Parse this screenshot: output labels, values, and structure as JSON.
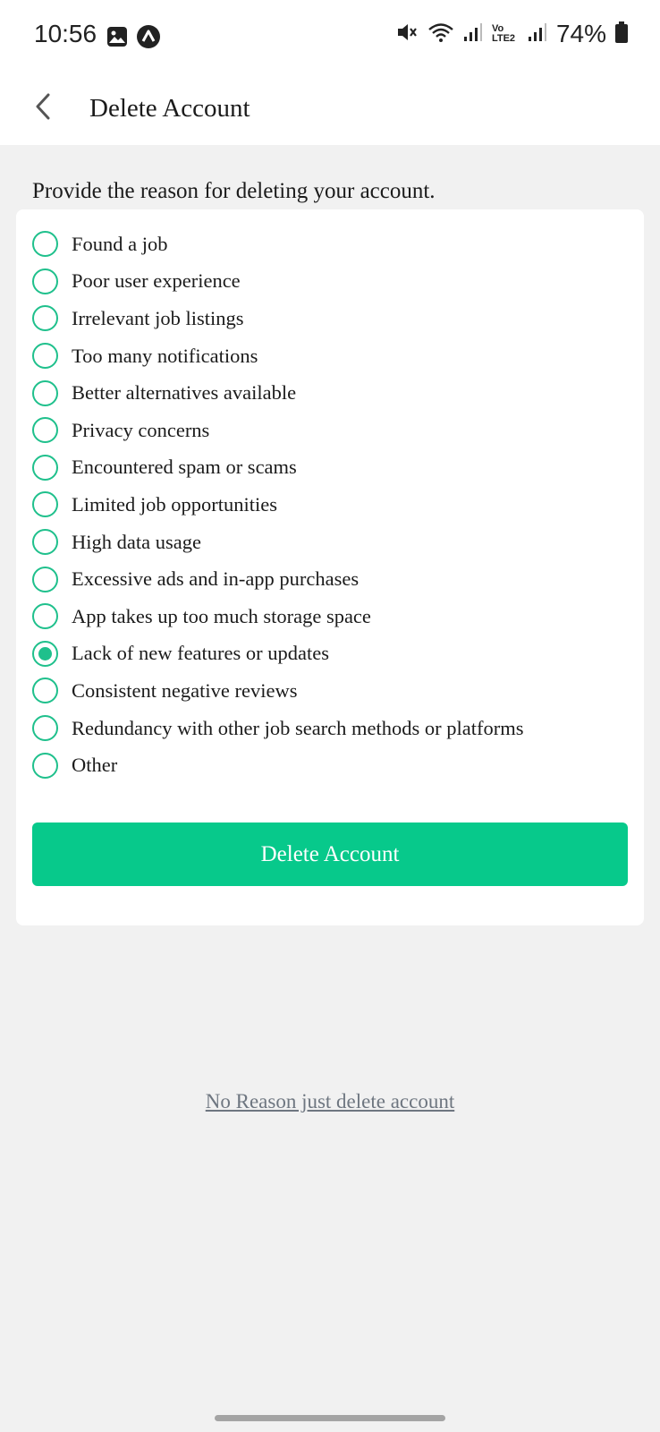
{
  "status_bar": {
    "time": "10:56",
    "battery": "74%",
    "lte_label": "Vo LTE2",
    "icons": [
      "image-icon",
      "app-notification-icon",
      "mute-icon",
      "wifi-icon",
      "signal-icon",
      "signal-icon",
      "battery-icon"
    ]
  },
  "header": {
    "title": "Delete Account",
    "back_icon": "chevron-left-icon"
  },
  "form": {
    "prompt": "Provide the reason for deleting your account.",
    "reasons": [
      {
        "label": "Found a job",
        "selected": false
      },
      {
        "label": "Poor user experience",
        "selected": false
      },
      {
        "label": "Irrelevant job listings",
        "selected": false
      },
      {
        "label": "Too many notifications",
        "selected": false
      },
      {
        "label": "Better alternatives available",
        "selected": false
      },
      {
        "label": "Privacy concerns",
        "selected": false
      },
      {
        "label": "Encountered spam or scams",
        "selected": false
      },
      {
        "label": "Limited job opportunities",
        "selected": false
      },
      {
        "label": "High data usage",
        "selected": false
      },
      {
        "label": "Excessive ads and in-app purchases",
        "selected": false
      },
      {
        "label": "App takes up too much storage space",
        "selected": false
      },
      {
        "label": "Lack of new features or updates",
        "selected": true
      },
      {
        "label": "Consistent negative reviews",
        "selected": false
      },
      {
        "label": "Redundancy with other job search methods or platforms",
        "selected": false
      },
      {
        "label": "Other",
        "selected": false
      }
    ],
    "submit_label": "Delete Account"
  },
  "no_reason_link": "No Reason just delete account",
  "colors": {
    "accent": "#07c98b",
    "radio": "#1fc08c",
    "background": "#f1f1f1",
    "link": "#6e7680"
  }
}
